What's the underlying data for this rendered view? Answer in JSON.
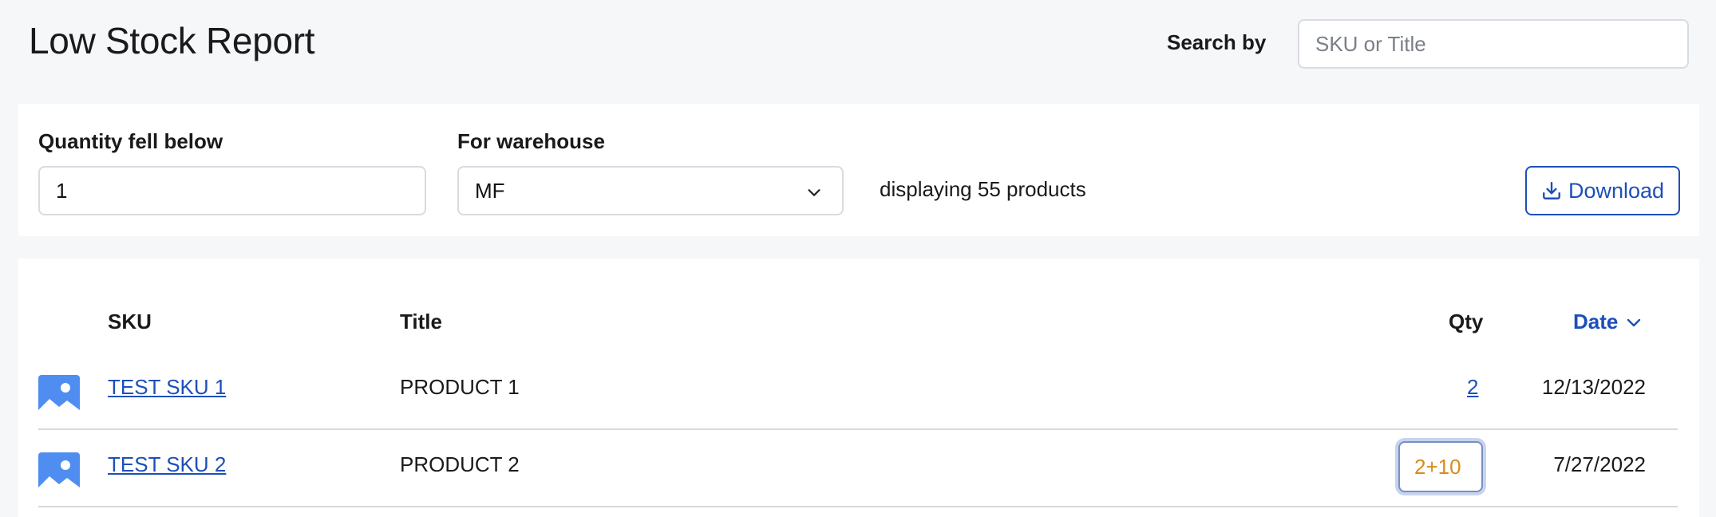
{
  "header": {
    "title": "Low Stock Report",
    "search_label": "Search by",
    "search_placeholder": "SKU or Title",
    "search_value": ""
  },
  "filters": {
    "qty_label": "Quantity fell below",
    "qty_value": "1",
    "warehouse_label": "For warehouse",
    "warehouse_selected": "MF",
    "display_count": "displaying 55 products",
    "download_label": "Download"
  },
  "table": {
    "columns": {
      "sku": "SKU",
      "title": "Title",
      "qty": "Qty",
      "date": "Date"
    },
    "rows": [
      {
        "sku": "TEST SKU 1",
        "title": "PRODUCT 1",
        "qty": "2",
        "date": "12/13/2022"
      },
      {
        "sku": "TEST SKU 2",
        "title": "PRODUCT 2",
        "qty_editing": "2+10",
        "date": "7/27/2022"
      }
    ]
  },
  "colors": {
    "accent": "#1d4fb8",
    "image_placeholder": "#4f8ef0",
    "editing_text": "#d98a1c"
  },
  "icons": {
    "select_arrow": "chevron-down-icon",
    "download": "download-icon",
    "sort": "chevron-down-icon",
    "thumbnail": "image-placeholder-icon"
  }
}
